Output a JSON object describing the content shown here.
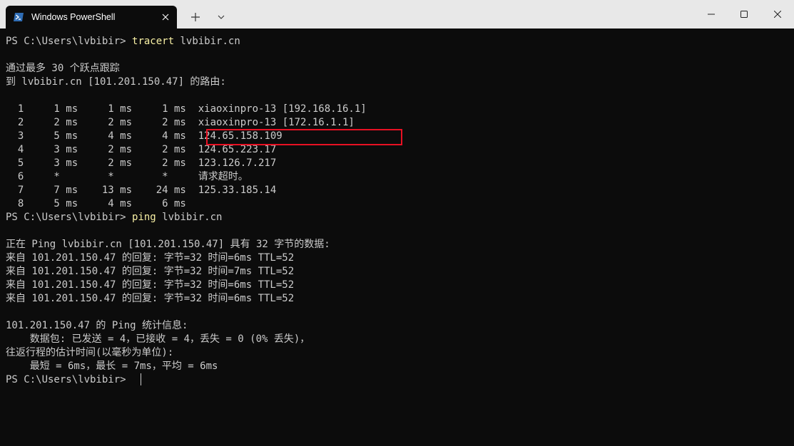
{
  "window": {
    "tab_title": "Windows PowerShell",
    "tab_icon": "powershell-icon",
    "accent": "#0c0c0c"
  },
  "terminal": {
    "lines": [
      {
        "prompt": "PS C:\\Users\\lvbibir> ",
        "command": "tracert",
        "args": " lvbibir.cn"
      },
      {
        "text": ""
      },
      {
        "text": "通过最多 30 个跃点跟踪"
      },
      {
        "text": "到 lvbibir.cn [101.201.150.47] 的路由:"
      },
      {
        "text": ""
      },
      {
        "text": "  1     1 ms     1 ms     1 ms  xiaoxinpro-13 [192.168.16.1]"
      },
      {
        "text": "  2     2 ms     2 ms     2 ms  xiaoxinpro-13 [172.16.1.1]"
      },
      {
        "text": "  3     5 ms     4 ms     4 ms  124.65.158.109"
      },
      {
        "text": "  4     3 ms     2 ms     2 ms  124.65.223.17"
      },
      {
        "text": "  5     3 ms     2 ms     2 ms  123.126.7.217"
      },
      {
        "text": "  6     *        *        *     请求超时。"
      },
      {
        "text": "  7     7 ms    13 ms    24 ms  125.33.185.14"
      },
      {
        "text": "  8     5 ms     4 ms     6 ms"
      },
      {
        "prompt": "PS C:\\Users\\lvbibir> ",
        "command": "ping",
        "args": " lvbibir.cn"
      },
      {
        "text": ""
      },
      {
        "text": "正在 Ping lvbibir.cn [101.201.150.47] 具有 32 字节的数据:"
      },
      {
        "text": "来自 101.201.150.47 的回复: 字节=32 时间=6ms TTL=52"
      },
      {
        "text": "来自 101.201.150.47 的回复: 字节=32 时间=7ms TTL=52"
      },
      {
        "text": "来自 101.201.150.47 的回复: 字节=32 时间=6ms TTL=52"
      },
      {
        "text": "来自 101.201.150.47 的回复: 字节=32 时间=6ms TTL=52"
      },
      {
        "text": ""
      },
      {
        "text": "101.201.150.47 的 Ping 统计信息:"
      },
      {
        "text": "    数据包: 已发送 = 4，已接收 = 4，丢失 = 0 (0% 丢失)，"
      },
      {
        "text": "往返行程的估计时间(以毫秒为单位):"
      },
      {
        "text": "    最短 = 6ms，最长 = 7ms，平均 = 6ms"
      },
      {
        "prompt": "PS C:\\Users\\lvbibir> ",
        "command": "",
        "args": ""
      }
    ],
    "highlight_color": "#e81123",
    "command_color": "#f9f1a5",
    "text_color": "#cccccc"
  }
}
